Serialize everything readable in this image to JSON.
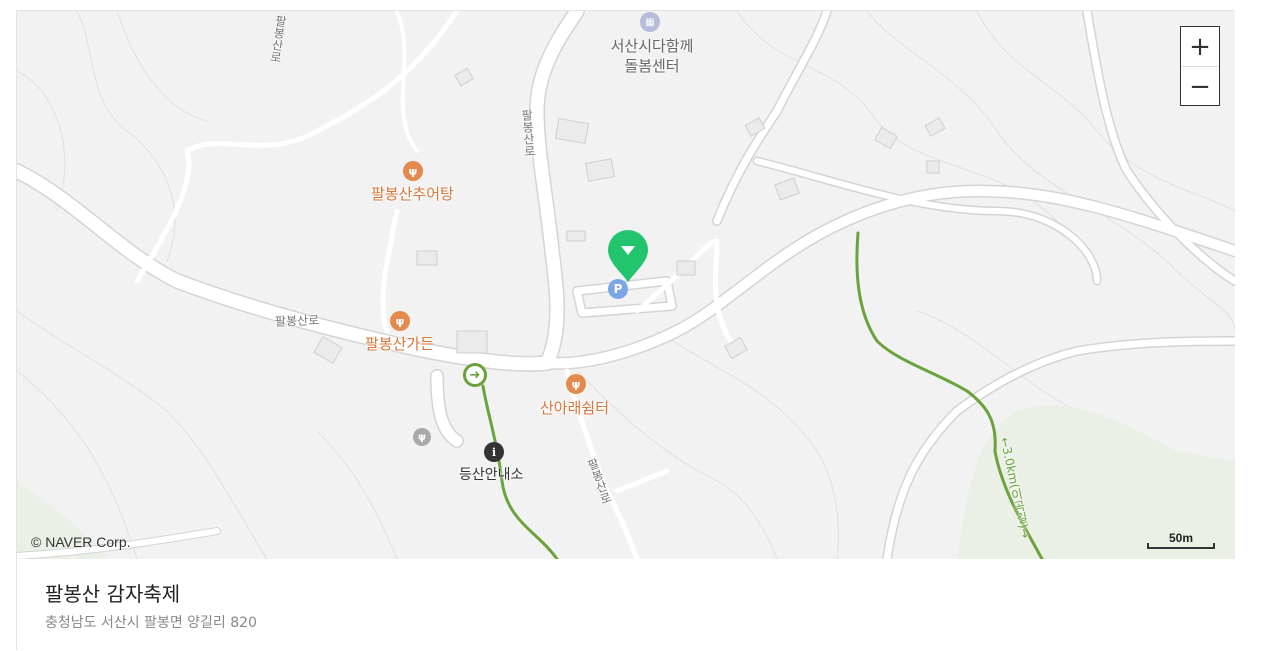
{
  "map": {
    "copyright": "© NAVER Corp.",
    "scale_label": "50m",
    "zoom_in_label": "+",
    "zoom_out_label": "−",
    "colors": {
      "background": "#f2f2f2",
      "road": "#ffffff",
      "road_outline": "#d6d6d6",
      "trail": "#6aa33c",
      "marker": "#22c46e",
      "parking": "#7aa6e8",
      "food": "#e48a4e"
    },
    "pois": [
      {
        "name": "서산시다함께\n돌봄센터",
        "type": "building",
        "icon": "building-icon"
      },
      {
        "name": "팔봉산추어탕",
        "type": "restaurant",
        "icon": "fork-knife-icon"
      },
      {
        "name": "팔봉산가든",
        "type": "restaurant",
        "icon": "fork-knife-icon"
      },
      {
        "name": "산아래쉼터",
        "type": "restaurant",
        "icon": "fork-knife-icon"
      },
      {
        "name": "등산안내소",
        "type": "info",
        "icon": "info-icon"
      }
    ],
    "road_labels": {
      "road_left_vertical": "팔봉산로",
      "road_center_vertical": "팔봉산로",
      "road_left_horizontal": "팔봉산로",
      "road_bottom": "팔봉산로"
    },
    "trail_label": "←3.0km(이곡길)→",
    "parking_label": "P",
    "marker_name": "destination-marker"
  },
  "place": {
    "name": "팔봉산 감자축제",
    "address": "충청남도 서산시 팔봉면 양길리 820"
  }
}
